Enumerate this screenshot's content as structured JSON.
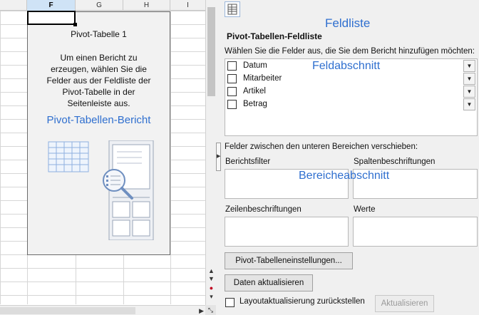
{
  "sheet": {
    "columns": [
      "F",
      "G",
      "H",
      "I"
    ],
    "selected_column": "F"
  },
  "pivot_placeholder": {
    "title": "Pivot-Tabelle 1",
    "description_lines": [
      "Um einen Bericht zu",
      "erzeugen, wählen Sie die",
      "Felder aus der Feldliste der",
      "Pivot-Tabelle in der",
      "Seitenleiste aus."
    ],
    "overlay_label": "Pivot-Tabellen-Bericht"
  },
  "sidebar": {
    "overlay_feldliste": "Feldliste",
    "title": "Pivot-Tabellen-Feldliste",
    "instruction": "Wählen Sie die Felder aus, die Sie dem Bericht hinzufügen möchten:",
    "fields": [
      {
        "label": "Datum",
        "checked": false
      },
      {
        "label": "Mitarbeiter",
        "checked": false
      },
      {
        "label": "Artikel",
        "checked": false
      },
      {
        "label": "Betrag",
        "checked": false
      }
    ],
    "overlay_feldabschnitt": "Feldabschnitt",
    "areas_instruction": "Felder zwischen den unteren Bereichen verschieben:",
    "areas": {
      "filter": "Berichtsfilter",
      "columns": "Spaltenbeschriftungen",
      "rows": "Zeilenbeschriftungen",
      "values": "Werte"
    },
    "overlay_bereichsabschnitt": "Bereicheabschnitt",
    "settings_button": "Pivot-Tabelleneinstellungen...",
    "refresh_button": "Daten aktualisieren",
    "defer_label": "Layoutaktualisierung zurückstellen",
    "defer_checked": false,
    "update_button": "Aktualisieren"
  },
  "colors": {
    "overlay_text": "#2f6fcf",
    "selected_header": "#cfe3f6",
    "panel_bg": "#f0f0f0"
  },
  "icons": [
    "field-list-layout-icon",
    "dropdown-arrow-icon",
    "scroll-up-icon",
    "scroll-down-icon",
    "scroll-right-icon",
    "collapse-sidebar-icon"
  ]
}
